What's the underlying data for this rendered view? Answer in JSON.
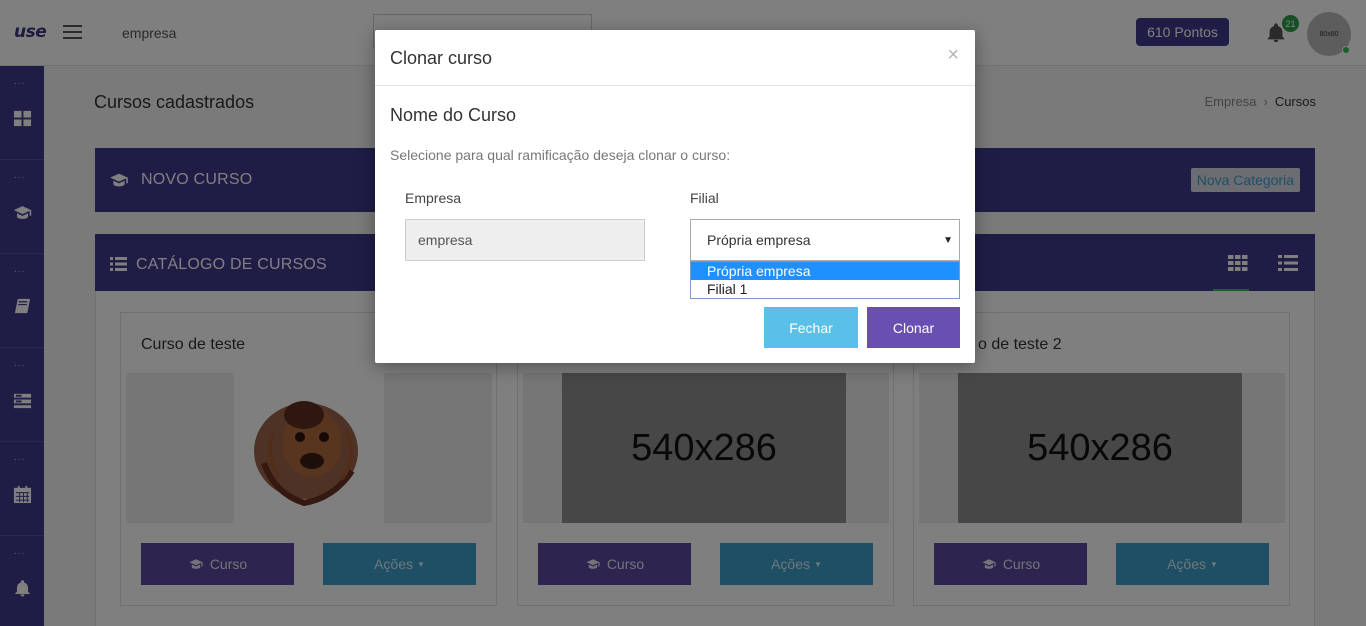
{
  "header": {
    "logo": "use",
    "company": "empresa",
    "points": "610 Pontos",
    "notifications": "21",
    "avatar_text": "80x80"
  },
  "sidebar": {
    "items": [
      {
        "dots": "...",
        "icon": "dashboard-icon"
      },
      {
        "dots": "...",
        "icon": "graduation-cap-icon"
      },
      {
        "dots": "...",
        "icon": "book-icon"
      },
      {
        "dots": "...",
        "icon": "list-icon"
      },
      {
        "dots": "...",
        "icon": "calendar-icon"
      },
      {
        "dots": "...",
        "icon": "bell-icon"
      }
    ]
  },
  "page": {
    "title": "Cursos cadastrados",
    "breadcrumb": [
      "Empresa",
      "Cursos"
    ]
  },
  "panels": {
    "new_course": "NOVO CURSO",
    "new_category_button": "Nova Categoria",
    "catalog": "CATÁLOGO DE CURSOS"
  },
  "cards": [
    {
      "title": "Curso de teste",
      "image": "photo",
      "curso_label": "Curso",
      "acoes_label": "Ações"
    },
    {
      "title": "",
      "image": "540x286",
      "curso_label": "Curso",
      "acoes_label": "Ações"
    },
    {
      "title": "o de teste 2",
      "image": "540x286",
      "curso_label": "Curso",
      "acoes_label": "Ações"
    }
  ],
  "modal": {
    "title": "Clonar curso",
    "close": "×",
    "course_name": "Nome do Curso",
    "instruction": "Selecione para qual ramificação deseja clonar o curso:",
    "empresa_label": "Empresa",
    "empresa_value": "empresa",
    "filial_label": "Filial",
    "filial_value": "Própria empresa",
    "filial_options": [
      "Própria empresa",
      "Filial 1"
    ],
    "fechar": "Fechar",
    "clonar": "Clonar"
  },
  "colors": {
    "primary": "#3f3a8c",
    "info": "#3f9fc8",
    "success": "#2c9e46",
    "clonar": "#6a4fb3",
    "fechar": "#5bc0e8"
  }
}
